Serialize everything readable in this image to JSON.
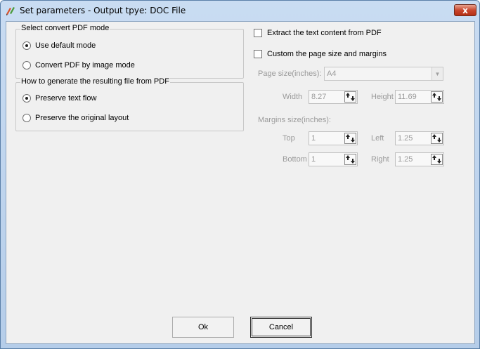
{
  "window": {
    "title": "Set parameters - Output tpye: DOC File",
    "close_label": "x"
  },
  "mode_group": {
    "legend": "Select convert PDF mode",
    "options": [
      {
        "label": "Use default mode",
        "selected": true
      },
      {
        "label": "Convert PDF by image mode",
        "selected": false
      }
    ]
  },
  "generate_group": {
    "legend": "How to generate the resulting file from PDF",
    "options": [
      {
        "label": "Preserve text flow",
        "selected": true
      },
      {
        "label": "Preserve the original layout",
        "selected": false
      }
    ]
  },
  "extract_text": {
    "label": "Extract the text content from PDF",
    "checked": false
  },
  "custom_page": {
    "label": "Custom the page size and margins",
    "checked": false
  },
  "page_size": {
    "label": "Page size(inches):",
    "value": "A4",
    "width_label": "Width",
    "width_value": "8.27",
    "height_label": "Height",
    "height_value": "11.69"
  },
  "margins": {
    "label": "Margins size(inches):",
    "top_label": "Top",
    "top_value": "1",
    "left_label": "Left",
    "left_value": "1.25",
    "bottom_label": "Bottom",
    "bottom_value": "1",
    "right_label": "Right",
    "right_value": "1.25"
  },
  "buttons": {
    "ok": "Ok",
    "cancel": "Cancel"
  },
  "colors": {
    "disabled_text": "#9a9a9a",
    "close_red": "#c9472e"
  }
}
